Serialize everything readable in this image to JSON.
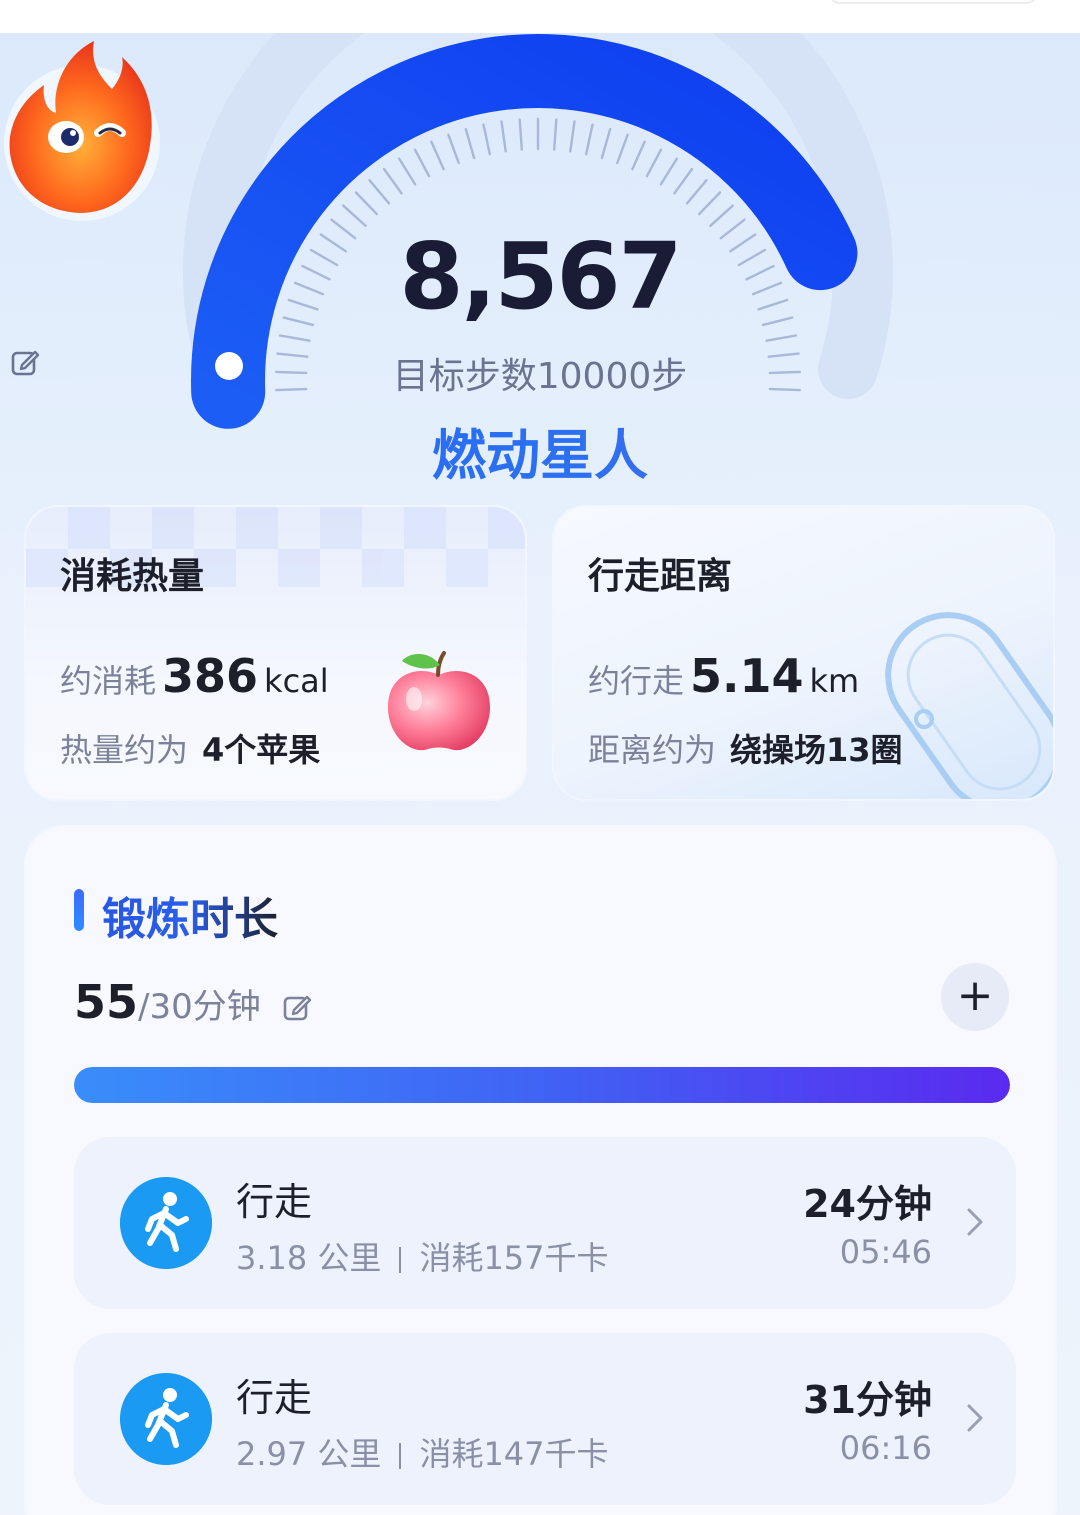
{
  "gauge": {
    "steps": "8,567",
    "goal_label": "目标步数10000步",
    "level_title": "燃动星人",
    "progress": 0.8567
  },
  "calories_card": {
    "title": "消耗热量",
    "line1_prefix": "约消耗",
    "value": "386",
    "unit": "kcal",
    "line2_prefix": "热量约为",
    "equivalent": "4个苹果"
  },
  "distance_card": {
    "title": "行走距离",
    "line1_prefix": "约行走",
    "value": "5.14",
    "unit": "km",
    "line2_prefix": "距离约为",
    "equivalent": "绕操场13圈"
  },
  "exercise": {
    "title": "锻炼时长",
    "minutes": "55",
    "target": "/30分钟",
    "add_label": "+",
    "progress": 1.0,
    "records": [
      {
        "name": "行走",
        "distance": "3.18 公里",
        "calories": "消耗157千卡",
        "duration": "24分钟",
        "time": "05:46"
      },
      {
        "name": "行走",
        "distance": "2.97 公里",
        "calories": "消耗147千卡",
        "duration": "31分钟",
        "time": "06:16"
      }
    ]
  },
  "colors": {
    "gauge_arc": "#1f5cf5",
    "accent_blue": "#2a6cf3",
    "walk_icon_bg": "#1a9af3",
    "progress_start": "#3a8dfb",
    "progress_end": "#5a2af0"
  },
  "icons": [
    "edit-icon",
    "flame-mascot-icon",
    "apple-icon",
    "walk-icon",
    "chevron-right-icon",
    "plus-icon"
  ]
}
